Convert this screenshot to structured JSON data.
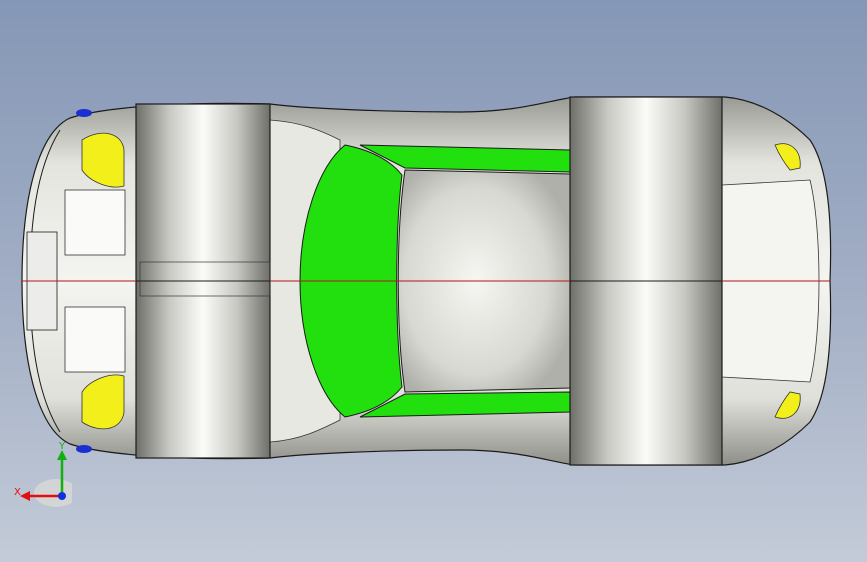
{
  "viewport": {
    "background_top": "#8597b6",
    "background_bottom": "#c3cbd8"
  },
  "model": {
    "body_color": "#d9d9d4",
    "glass_color": "#22e00e",
    "light_color": "#f2ef1a",
    "marker_color": "#1b2fd0",
    "centerline_color": "#b01818",
    "edge_color": "#1a1a1a"
  },
  "triad": {
    "x_label": "X",
    "y_label": "Y",
    "x_color": "#e01010",
    "y_color": "#10b010",
    "z_color": "#1030e0"
  }
}
